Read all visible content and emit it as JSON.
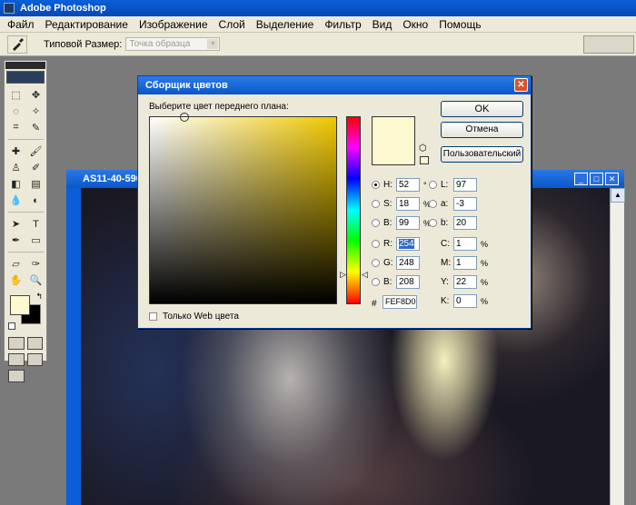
{
  "app": {
    "title": "Adobe Photoshop"
  },
  "menu": [
    "Файл",
    "Редактирование",
    "Изображение",
    "Слой",
    "Выделение",
    "Фильтр",
    "Вид",
    "Окно",
    "Помощь"
  ],
  "options_bar": {
    "sample_size_label": "Типовой Размер:",
    "sample_size_value": "Точка образца"
  },
  "document": {
    "title": "AS11-40-590"
  },
  "dialog": {
    "title": "Сборщик цветов",
    "prompt": "Выберите цвет переднего плана:",
    "ok": "OK",
    "cancel": "Отмена",
    "custom": "Пользовательский",
    "web_only": "Только Web цвета",
    "hex_label": "#",
    "hex": "FEF8D0",
    "preview_color": "#fef8d0",
    "hsb": [
      {
        "label": "H:",
        "value": "52",
        "unit": "°",
        "selected": true
      },
      {
        "label": "S:",
        "value": "18",
        "unit": "%"
      },
      {
        "label": "B:",
        "value": "99",
        "unit": "%"
      }
    ],
    "rgb": [
      {
        "label": "R:",
        "value": "254"
      },
      {
        "label": "G:",
        "value": "248"
      },
      {
        "label": "B:",
        "value": "208"
      }
    ],
    "lab": [
      {
        "label": "L:",
        "value": "97"
      },
      {
        "label": "a:",
        "value": "-3"
      },
      {
        "label": "b:",
        "value": "20"
      }
    ],
    "cmyk": [
      {
        "label": "C:",
        "value": "1",
        "unit": "%"
      },
      {
        "label": "M:",
        "value": "1",
        "unit": "%"
      },
      {
        "label": "Y:",
        "value": "22",
        "unit": "%"
      },
      {
        "label": "K:",
        "value": "0",
        "unit": "%"
      }
    ]
  }
}
